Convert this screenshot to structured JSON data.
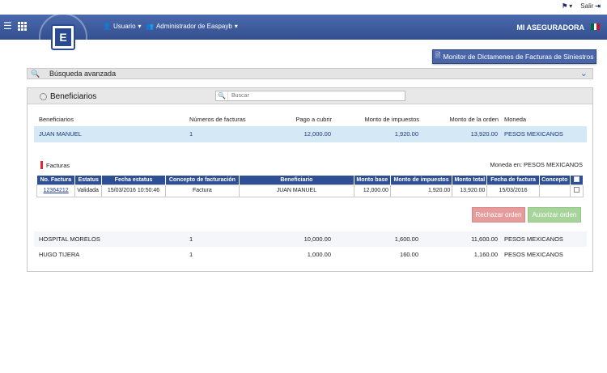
{
  "topbar": {
    "help_icon": "help-flag-icon",
    "logout_label": "Salir"
  },
  "navbar": {
    "user_label": "Usuario",
    "admin_label": "Administrador de Easpayb",
    "brand": "MI ASEGURADORA",
    "logo_letter": "E",
    "flag_colors": [
      "#006847",
      "#ffffff",
      "#ce1126"
    ]
  },
  "monitor_button": "Monitor de Dictamenes de Facturas de Siniestros",
  "advanced_search": {
    "label": "Búsqueda avanzada"
  },
  "beneficiarios": {
    "title": "Beneficiarios",
    "search_placeholder": "Buscar",
    "columns": [
      "Beneficiarios",
      "Números de facturas",
      "Pago a cubrir",
      "Monto de impuestos",
      "Monto de la orden",
      "Moneda"
    ],
    "rows": [
      [
        "JUAN MANUEL",
        "1",
        "12,000.00",
        "1,920.00",
        "13,920.00",
        "PESOS MEXICANOS"
      ],
      [
        "HOSPITAL MORELOS",
        "1",
        "10,000.00",
        "1,600.00",
        "11,600.00",
        "PESOS MEXICANOS"
      ],
      [
        "HUGO TIJERA",
        "1",
        "1,000.00",
        "160.00",
        "1,160.00",
        "PESOS MEXICANOS"
      ]
    ]
  },
  "facturas": {
    "label": "Facturas",
    "moneda_en": "Moneda en: PESOS MEXICANOS",
    "columns": [
      "No. Factura",
      "Estatus",
      "Fecha estatus",
      "Concepto de facturación",
      "Beneficiario",
      "Monto base",
      "Monto de impuestos",
      "Monto total",
      "Fecha de factura",
      "Concepto"
    ],
    "row": [
      "12364212",
      "Validada",
      "15/03/2016 10:50:46",
      "Factura",
      "JUAN MANUEL",
      "12,000.00",
      "1,920.00",
      "13,920.00",
      "15/03/2016",
      ""
    ]
  },
  "actions": {
    "reject": "Rechazar orden",
    "authorize": "Autorizar orden"
  }
}
